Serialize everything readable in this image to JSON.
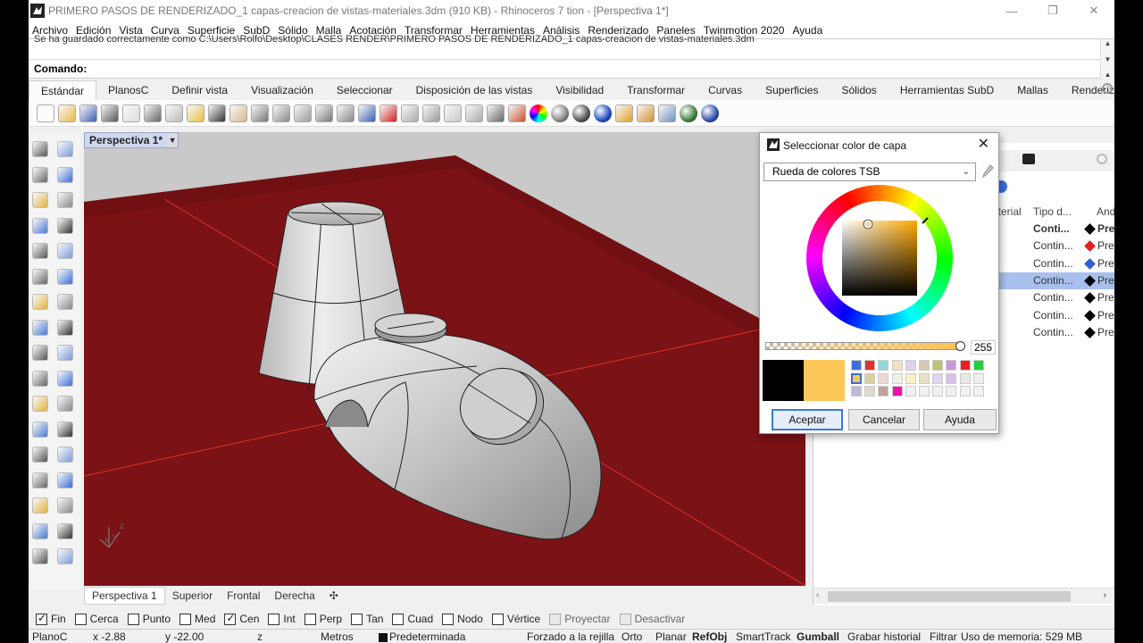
{
  "window": {
    "title": "PRIMERO PASOS DE RENDERIZADO_1 capas-creacion de vistas-materiales.3dm (910 KB) - Rhinoceros 7 tion - [Perspectiva 1*]",
    "min_glyph": "—",
    "max_glyph": "❐",
    "close_glyph": "✕"
  },
  "menu": [
    "Archivo",
    "Edición",
    "Vista",
    "Curva",
    "Superficie",
    "SubD",
    "Sólido",
    "Malla",
    "Acotación",
    "Transformar",
    "Herramientas",
    "Análisis",
    "Renderizado",
    "Paneles",
    "Twinmotion 2020",
    "Ayuda"
  ],
  "command": {
    "history": "Se ha guardado correctamente como C:\\Users\\Rolfo\\Desktop\\CLASES RENDER\\PRIMERO PASOS DE RENDERIZADO_1 capas-creacion de vistas-materiales.3dm",
    "prompt": "Comando:"
  },
  "tabs": [
    "Estándar",
    "PlanosC",
    "Definir vista",
    "Visualización",
    "Seleccionar",
    "Disposición de las vistas",
    "Visibilidad",
    "Transformar",
    "Curvas",
    "Superficies",
    "Sólidos",
    "Herramientas SubD",
    "Mallas",
    "Renderiz"
  ],
  "toolbar_icons": [
    "new-icon",
    "open-icon",
    "save-icon",
    "print-icon",
    "import-icon",
    "cut-icon",
    "copy-icon",
    "paste-icon",
    "undo-icon",
    "pan-icon",
    "rotate-icon",
    "zoom-icon",
    "zoom-window-icon",
    "zoom-extents-icon",
    "zoom-selected-icon",
    "four-views-icon",
    "car-icon",
    "grid-icon",
    "snap-icon",
    "properties-icon",
    "light-icon",
    "lock-icon",
    "layer-icon",
    "color-wheel-icon",
    "shaded-sphere-icon",
    "render-sphere-icon",
    "material-sphere-icon",
    "spotlight-icon",
    "gear-icon",
    "options-icon",
    "globe-icon",
    "help-icon"
  ],
  "viewport": {
    "title": "Perspectiva 1*",
    "dropdown_glyph": "▼",
    "axes": {
      "x": "x",
      "y": "y",
      "z": "z"
    }
  },
  "viewport_tabs": [
    "Perspectiva 1",
    "Superior",
    "Frontal",
    "Derecha",
    "✣"
  ],
  "layers_panel": {
    "columns": [
      "aterial",
      "Tipo d...",
      "And"
    ],
    "rows": [
      {
        "linetype": "Conti...",
        "bold": true,
        "color": "#000000",
        "print": "Pre",
        "selected": false
      },
      {
        "linetype": "Contin...",
        "bold": false,
        "color": "#e02020",
        "print": "Pre",
        "selected": false
      },
      {
        "linetype": "Contin...",
        "bold": false,
        "color": "#3060d0",
        "print": "Pre",
        "selected": false
      },
      {
        "linetype": "Contin...",
        "bold": false,
        "color": "#000000",
        "print": "Pre",
        "selected": true
      },
      {
        "linetype": "Contin...",
        "bold": false,
        "color": "#000000",
        "print": "Pre",
        "selected": false
      },
      {
        "linetype": "Contin...",
        "bold": false,
        "color": "#000000",
        "print": "Pre",
        "selected": false
      },
      {
        "linetype": "Contin...",
        "bold": false,
        "color": "#000000",
        "print": "Pre",
        "selected": false
      }
    ],
    "scroll_left": "‹",
    "scroll_right": "›"
  },
  "dialog": {
    "title": "Seleccionar color de capa",
    "close_glyph": "✕",
    "mode": "Rueda de colores TSB",
    "mode_arrow": "⌄",
    "alpha_value": "255",
    "alpha_fraction": 1.0,
    "old_color": "#000000",
    "new_color": "#fbc759",
    "swatches": [
      "#3a6ee0",
      "#e03030",
      "#8fd8d8",
      "#f0e0c0",
      "#e0d0e8",
      "#d8c8b0",
      "#c0c070",
      "#c898d8",
      "#f02020",
      "#20d040",
      "#f8c858",
      "#d8d0a0",
      "#f0d8d8",
      "#f0f0e0",
      "#f8f0c8",
      "#e8e0c8",
      "#e0d8f0",
      "#d8c0e8",
      "#e8e8e8",
      "#f0f0f0",
      "#c0b8d8",
      "#e0d8c8",
      "#c0a0a0",
      "#f010b0",
      "#f0f0f0",
      "#f0f0f0",
      "#f0f0f0",
      "#f0f0f0",
      "#f0f0f0",
      "#f0f0f0"
    ],
    "buttons": {
      "accept": "Aceptar",
      "cancel": "Cancelar",
      "help": "Ayuda"
    }
  },
  "osnaps": [
    {
      "label": "Fin",
      "checked": true,
      "enabled": true
    },
    {
      "label": "Cerca",
      "checked": false,
      "enabled": true
    },
    {
      "label": "Punto",
      "checked": false,
      "enabled": true
    },
    {
      "label": "Med",
      "checked": false,
      "enabled": true
    },
    {
      "label": "Cen",
      "checked": true,
      "enabled": true
    },
    {
      "label": "Int",
      "checked": false,
      "enabled": true
    },
    {
      "label": "Perp",
      "checked": false,
      "enabled": true
    },
    {
      "label": "Tan",
      "checked": false,
      "enabled": true
    },
    {
      "label": "Cuad",
      "checked": false,
      "enabled": true
    },
    {
      "label": "Nodo",
      "checked": false,
      "enabled": true
    },
    {
      "label": "Vértice",
      "checked": false,
      "enabled": true
    },
    {
      "label": "Proyectar",
      "checked": false,
      "enabled": false
    },
    {
      "label": "Desactivar",
      "checked": false,
      "enabled": false
    }
  ],
  "status": {
    "cplane": "PlanoC",
    "x": "x -2.88",
    "y": "y -22.00",
    "z": "z",
    "units": "Metros",
    "layer": "Predeterminada",
    "grid_snap": "Forzado a la rejilla",
    "ortho": "Orto",
    "planar": "Planar",
    "osnap": "RefObj",
    "smarttrack": "SmartTrack",
    "gumball": "Gumball",
    "history": "Grabar historial",
    "filter": "Filtrar",
    "memory": "Uso de memoria: 529 MB"
  }
}
